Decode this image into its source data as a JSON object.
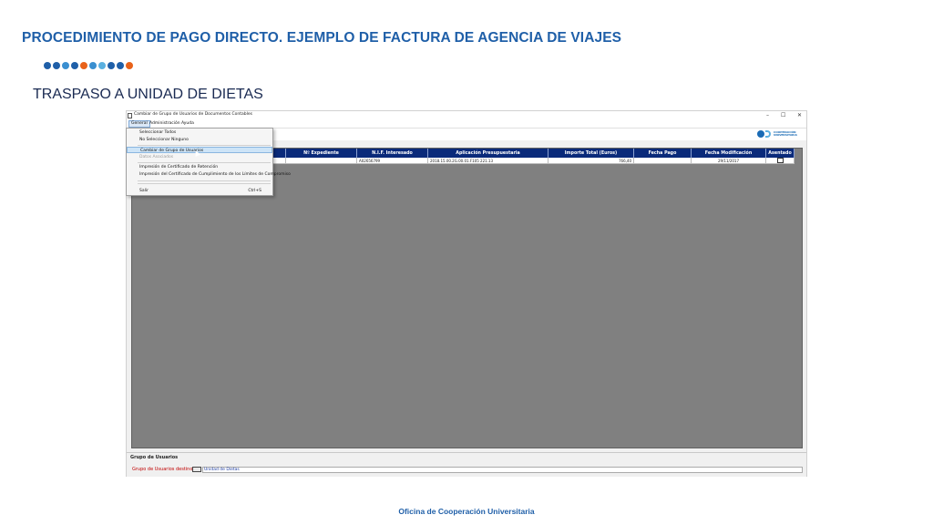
{
  "slide": {
    "title": "PROCEDIMIENTO DE PAGO DIRECTO. EJEMPLO DE FACTURA DE AGENCIA DE VIAJES",
    "subtitle": "TRASPASO A UNIDAD DE DIETAS",
    "footer": "Oficina de Cooperación Universitaria",
    "dot_colors": [
      "#1f5fa8",
      "#1f5fa8",
      "#3a8fd0",
      "#1f5fa8",
      "#e8621a",
      "#3a8fd0",
      "#5ab0e0",
      "#1f5fa8",
      "#1f5fa8",
      "#e8621a"
    ]
  },
  "window": {
    "title": "Cambiar de Grupo de Usuarios de Documentos Contables",
    "controls": {
      "minimize": "–",
      "maximize": "☐",
      "close": "✕"
    },
    "menu": [
      "General",
      "Administración",
      "Ayuda"
    ],
    "logo_text": [
      "COOPERACIÓN",
      "UNIVERSITARIA"
    ]
  },
  "dropdown": {
    "items": [
      {
        "label": "Seleccionar Todos",
        "state": "normal"
      },
      {
        "label": "No Seleccionar Ninguno",
        "state": "normal"
      },
      {
        "label": "Cambiar de Grupo de Usuarios",
        "state": "highlight"
      },
      {
        "label": "Datos Asociados",
        "state": "disabled"
      },
      {
        "label": "Impresión de Certificado de Retención",
        "state": "normal"
      },
      {
        "label": "Impresión del Certificado de Cumplimiento de los Límites de Compromiso",
        "state": "normal"
      },
      {
        "label": "Salir",
        "state": "normal",
        "shortcut": "Ctrl+S"
      }
    ]
  },
  "table": {
    "headers": [
      "Nº Expediente",
      "N.I.F. Interesado",
      "Aplicación Presupuestaria",
      "Importe Total (Euros)",
      "Fecha Pago",
      "Fecha Modificación",
      "Asentado"
    ],
    "row": [
      "",
      "A02656799",
      "2018.15.00.2G.00.01.F105    221.13",
      "766,40",
      "",
      "29/11/2017",
      ""
    ]
  },
  "group": {
    "title": "Grupo de Usuarios",
    "label": "Grupo de Usuarios destino",
    "value": "Unidad de Dietas"
  }
}
